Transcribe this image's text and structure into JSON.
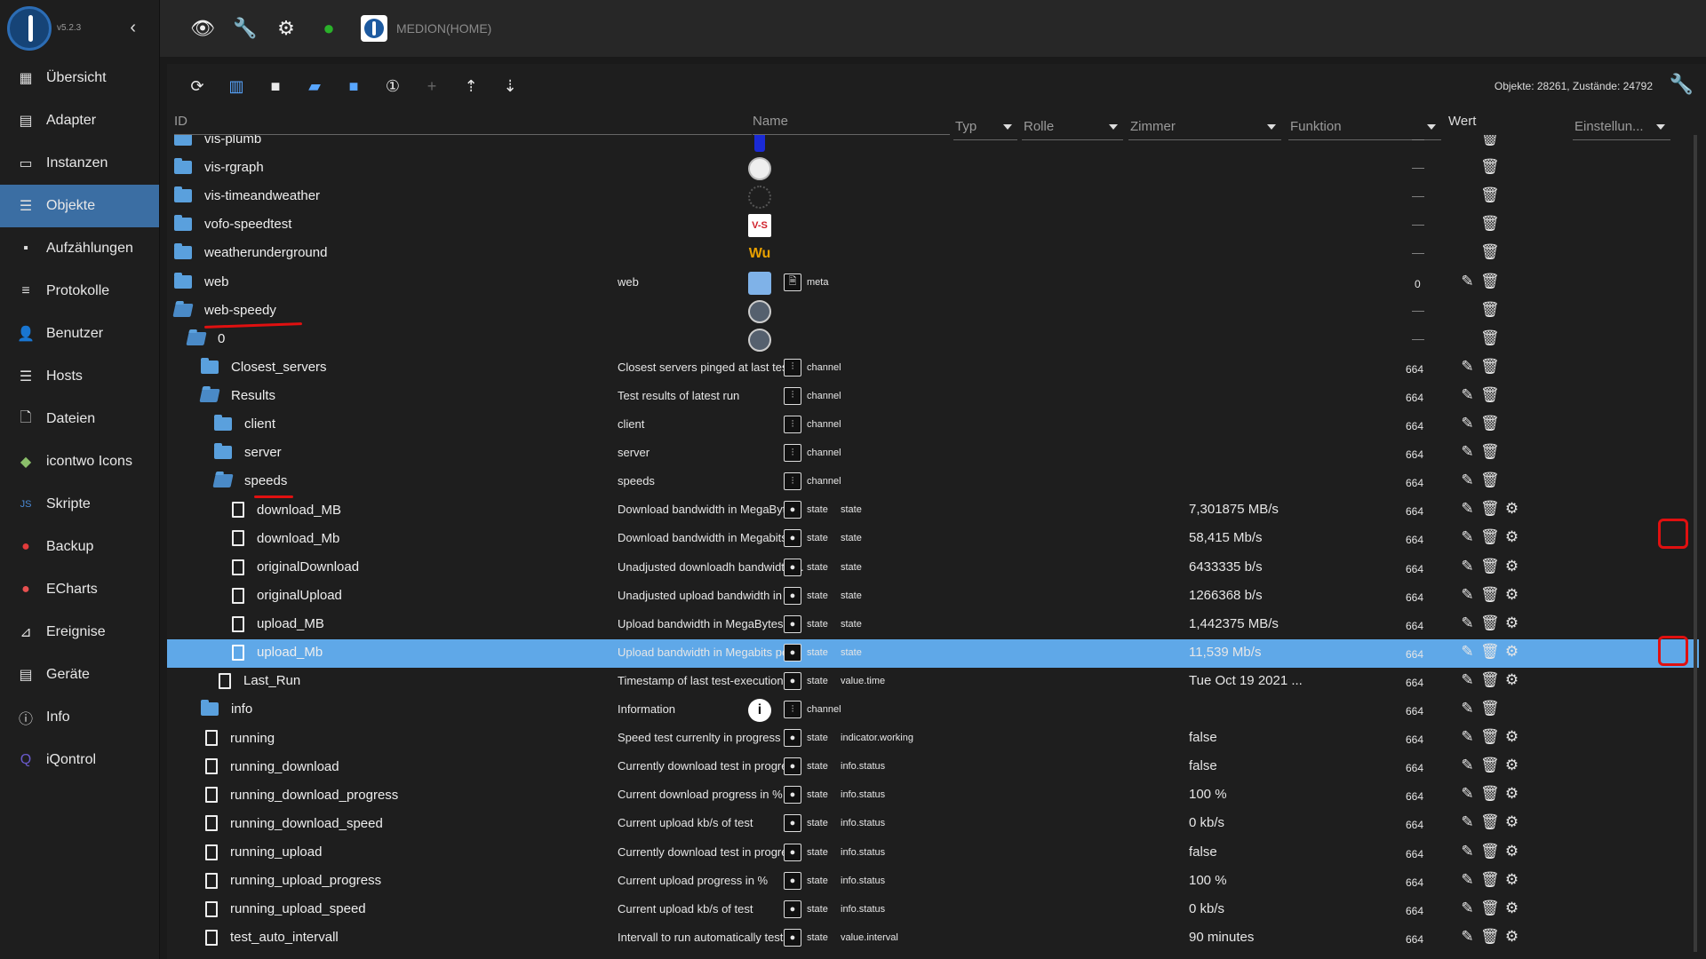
{
  "app": {
    "version": "v5.2.3",
    "host": "MEDION(HOME)"
  },
  "colors": {
    "accent": "#3b6ea3",
    "selected_row": "#5fa8e8",
    "folder": "#5aa0dd",
    "annotation": "#e01010"
  },
  "sidebar": {
    "items": [
      {
        "label": "Übersicht",
        "icon": "grid-icon"
      },
      {
        "label": "Adapter",
        "icon": "store-icon"
      },
      {
        "label": "Instanzen",
        "icon": "instances-icon"
      },
      {
        "label": "Objekte",
        "icon": "list-icon",
        "active": true
      },
      {
        "label": "Aufzählungen",
        "icon": "enum-icon"
      },
      {
        "label": "Protokolle",
        "icon": "log-icon"
      },
      {
        "label": "Benutzer",
        "icon": "user-icon"
      },
      {
        "label": "Hosts",
        "icon": "hosts-icon"
      },
      {
        "label": "Dateien",
        "icon": "files-icon"
      },
      {
        "label": "icontwo Icons",
        "icon": "icontwo-icon"
      },
      {
        "label": "Skripte",
        "icon": "scripts-icon"
      },
      {
        "label": "Backup",
        "icon": "backup-icon"
      },
      {
        "label": "ECharts",
        "icon": "echarts-icon"
      },
      {
        "label": "Ereignise",
        "icon": "events-icon"
      },
      {
        "label": "Geräte",
        "icon": "devices-icon"
      },
      {
        "label": "Info",
        "icon": "info-icon"
      },
      {
        "label": "iQontrol",
        "icon": "iqontrol-icon"
      }
    ]
  },
  "toolbar": {
    "counts": "Objekte: 28261, Zustände: 24792"
  },
  "columns": {
    "id": "ID",
    "name": "Name",
    "typ": "Typ",
    "rolle": "Rolle",
    "zimmer": "Zimmer",
    "funktion": "Funktion",
    "wert": "Wert",
    "einstellungen": "Einstellun..."
  },
  "rows": [
    {
      "id": "vis-plumb",
      "kind": "folder",
      "ricon": "plumb",
      "dash": "—"
    },
    {
      "id": "vis-rgraph",
      "kind": "folder",
      "ricon": "clock",
      "dash": "—"
    },
    {
      "id": "vis-timeandweather",
      "kind": "folder",
      "ricon": "dots",
      "dash": "—"
    },
    {
      "id": "vofo-speedtest",
      "kind": "folder",
      "ricon": "vs",
      "ricon_text": "V-S",
      "dash": "—"
    },
    {
      "id": "weatherunderground",
      "kind": "folder",
      "ricon": "wu",
      "ricon_text": "Wu",
      "dash": "—"
    },
    {
      "id": "web",
      "kind": "folder",
      "ricon": "web",
      "name": "web",
      "typ": "meta",
      "acl": "0"
    },
    {
      "id": "web-speedy",
      "kind": "folder-open",
      "ricon": "gauge",
      "dash": "—"
    },
    {
      "id": "0",
      "kind": "folder-open",
      "ricon": "gauge",
      "dash": "—"
    },
    {
      "id": "Closest_servers",
      "kind": "folder",
      "name": "Closest servers pinged at last test",
      "typ": "channel",
      "acl": "664"
    },
    {
      "id": "Results",
      "kind": "folder-open",
      "name": "Test results of latest run",
      "typ": "channel",
      "acl": "664"
    },
    {
      "id": "client",
      "kind": "folder",
      "name": "client",
      "typ": "channel",
      "acl": "664"
    },
    {
      "id": "server",
      "kind": "folder",
      "name": "server",
      "typ": "channel",
      "acl": "664"
    },
    {
      "id": "speeds",
      "kind": "folder-open",
      "name": "speeds",
      "typ": "channel",
      "acl": "664"
    },
    {
      "id": "download_MB",
      "kind": "file",
      "name": "Download bandwidth in MegaByte...",
      "typ": "state",
      "rolle": "state",
      "wert": "7,301875 MB/s",
      "acl": "664"
    },
    {
      "id": "download_Mb",
      "kind": "file",
      "name": "Download bandwidth in Megabits ...",
      "typ": "state",
      "rolle": "state",
      "wert": "58,415 Mb/s",
      "acl": "664"
    },
    {
      "id": "originalDownload",
      "kind": "file",
      "name": "Unadjusted downloadh bandwidth ...",
      "typ": "state",
      "rolle": "state",
      "wert": "6433335 b/s",
      "acl": "664"
    },
    {
      "id": "originalUpload",
      "kind": "file",
      "name": "Unadjusted upload bandwidth in b...",
      "typ": "state",
      "rolle": "state",
      "wert": "1266368 b/s",
      "acl": "664"
    },
    {
      "id": "upload_MB",
      "kind": "file",
      "name": "Upload bandwidth in MegaBytes p...",
      "typ": "state",
      "rolle": "state",
      "wert": "1,442375 MB/s",
      "acl": "664"
    },
    {
      "id": "upload_Mb",
      "kind": "file",
      "name": "Upload bandwidth in Megabits per...",
      "typ": "state",
      "rolle": "state",
      "wert": "11,539 Mb/s",
      "acl": "664",
      "selected": true
    },
    {
      "id": "Last_Run",
      "kind": "file",
      "name": "Timestamp of last test-execution",
      "typ": "state",
      "rolle": "value.time",
      "wert": "Tue Oct 19 2021 ...",
      "acl": "664"
    },
    {
      "id": "info",
      "kind": "folder",
      "ricon": "info",
      "ricon_text": "i",
      "name": "Information",
      "typ": "channel",
      "acl": "664"
    },
    {
      "id": "running",
      "kind": "file",
      "name": "Speed test currenlty in progress ?",
      "typ": "state",
      "rolle": "indicator.working",
      "wert": "false",
      "acl": "664"
    },
    {
      "id": "running_download",
      "kind": "file",
      "name": "Currently download test in progre...",
      "typ": "state",
      "rolle": "info.status",
      "wert": "false",
      "acl": "664"
    },
    {
      "id": "running_download_progress",
      "kind": "file",
      "name": "Current download progress in %",
      "typ": "state",
      "rolle": "info.status",
      "wert": "100 %",
      "acl": "664"
    },
    {
      "id": "running_download_speed",
      "kind": "file",
      "name": "Current upload kb/s of test",
      "typ": "state",
      "rolle": "info.status",
      "wert": "0 kb/s",
      "acl": "664"
    },
    {
      "id": "running_upload",
      "kind": "file",
      "name": "Currently download test in progre...",
      "typ": "state",
      "rolle": "info.status",
      "wert": "false",
      "acl": "664"
    },
    {
      "id": "running_upload_progress",
      "kind": "file",
      "name": "Current upload progress in %",
      "typ": "state",
      "rolle": "info.status",
      "wert": "100 %",
      "acl": "664"
    },
    {
      "id": "running_upload_speed",
      "kind": "file",
      "name": "Current upload kb/s of test",
      "typ": "state",
      "rolle": "info.status",
      "wert": "0 kb/s",
      "acl": "664"
    },
    {
      "id": "test_auto_intervall",
      "kind": "file",
      "name": "Intervall to run automatically tests ...",
      "typ": "state",
      "rolle": "value.interval",
      "wert": "90 minutes",
      "acl": "664"
    }
  ]
}
